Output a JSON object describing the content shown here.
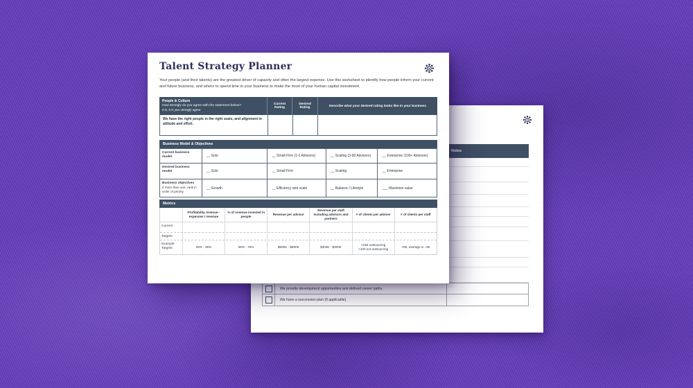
{
  "colors": {
    "background_purple": "#6d46c2",
    "header_bar": "#3f5064",
    "accent_navy": "#2b3157",
    "page_bg": "#ffffff"
  },
  "icons": {
    "front_logo": "dots-gear-logo",
    "back_logo": "dots-gear-logo"
  },
  "front_page": {
    "title": "Talent Strategy Planner",
    "intro": "Your people (and their talents) are the greatest driver of capacity and often the largest expense. Use this worksheet to identify how people inform your current and future business, and where to spend time in your business to make the most of your human capital investment.",
    "people_culture": {
      "title": "People & Culture",
      "subtitle": "How strongly do you agree with the statement below?",
      "scale_note": "0-5, 5 is you strongly agree",
      "col_current": "Current Rating",
      "col_desired": "Desired Rating",
      "col_describe": "Describe what your desired rating looks like in your business",
      "statement": "We have the right people in the right seats, and alignment in attitude and effort."
    },
    "business_model": {
      "title": "Business Model & Objectives",
      "rows": [
        {
          "label": "Current business model",
          "sublabel": "",
          "opt1": "__ Solo",
          "opt2": "__ Small Firm (1-2 Advisors)",
          "opt3": "__ Scaling (3-99 Advisors)",
          "opt4": "__ Enterprise (100+ Advisors)"
        },
        {
          "label": "Desired business model",
          "sublabel": "",
          "opt1": "__ Solo",
          "opt2": "__ Small Firm",
          "opt3": "__ Scaling",
          "opt4": "__ Enterprise"
        },
        {
          "label": "Business objectives",
          "sublabel": "If more than one, rank in order of priority",
          "opt1": "__ Growth",
          "opt2": "__ Efficiency and scale",
          "opt3": "__ Balance / Lifestyle",
          "opt4": "___ Maximize value"
        }
      ]
    },
    "metrics": {
      "title": "Metrics",
      "col1": "Profitability revenue - expenses / revenue",
      "col2": "% of revenue invested in people",
      "col3": "Revenue per advisor",
      "col4": "Revenue per staff including advisors and partners",
      "col5": "# of clients per advisor",
      "col6": "# of clients per staff",
      "row_current_label": "Current",
      "row_targets_label": "Targets",
      "row_example_label": "Example Targets",
      "example": {
        "v1": "25% - 35%",
        "v2": "65% - 75%",
        "v3": "$600K - $800K",
        "v4": "$300K - $400K",
        "v5": "<150 outsourcing\n<100 not outsourcing",
        "v6": "<60, average is ~35"
      }
    }
  },
  "back_page": {
    "notes_header": "Notes",
    "checklist": {
      "item1": "We provide development opportunities and defined career paths.",
      "item2": "We have a succession plan (if applicable)."
    }
  }
}
